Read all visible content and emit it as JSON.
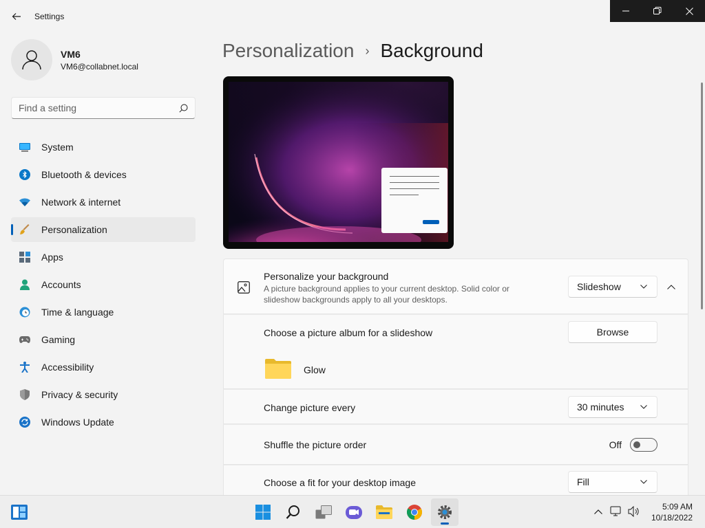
{
  "window": {
    "app_title": "Settings"
  },
  "profile": {
    "name": "VM6",
    "email": "VM6@collabnet.local"
  },
  "search": {
    "placeholder": "Find a setting"
  },
  "nav": {
    "items": [
      {
        "label": "System",
        "icon": "system-icon"
      },
      {
        "label": "Bluetooth & devices",
        "icon": "bluetooth-icon"
      },
      {
        "label": "Network & internet",
        "icon": "wifi-icon"
      },
      {
        "label": "Personalization",
        "icon": "brush-icon",
        "active": true
      },
      {
        "label": "Apps",
        "icon": "apps-icon"
      },
      {
        "label": "Accounts",
        "icon": "accounts-icon"
      },
      {
        "label": "Time & language",
        "icon": "clock-globe-icon"
      },
      {
        "label": "Gaming",
        "icon": "gamepad-icon"
      },
      {
        "label": "Accessibility",
        "icon": "accessibility-icon"
      },
      {
        "label": "Privacy & security",
        "icon": "shield-icon"
      },
      {
        "label": "Windows Update",
        "icon": "update-icon"
      }
    ]
  },
  "breadcrumb": {
    "parent": "Personalization",
    "separator": "›",
    "current": "Background"
  },
  "background": {
    "title": "Personalize your background",
    "description": "A picture background applies to your current desktop. Solid color or slideshow backgrounds apply to all your desktops.",
    "type_value": "Slideshow",
    "album_label": "Choose a picture album for a slideshow",
    "browse_label": "Browse",
    "folder_name": "Glow",
    "interval_label": "Change picture every",
    "interval_value": "30 minutes",
    "shuffle_label": "Shuffle the picture order",
    "shuffle_state": "Off",
    "fit_label": "Choose a fit for your desktop image",
    "fit_value": "Fill"
  },
  "taskbar": {
    "apps": [
      "start-icon",
      "search-icon",
      "task-view-icon",
      "chat-icon",
      "file-explorer-icon",
      "chrome-icon",
      "settings-icon"
    ],
    "tray": [
      "chevron-up-icon",
      "network-icon",
      "volume-icon"
    ],
    "time": "5:09 AM",
    "date": "10/18/2022"
  },
  "colors": {
    "accent": "#005fb8",
    "background": "#f3f3f3",
    "card": "#fbfbfb"
  }
}
